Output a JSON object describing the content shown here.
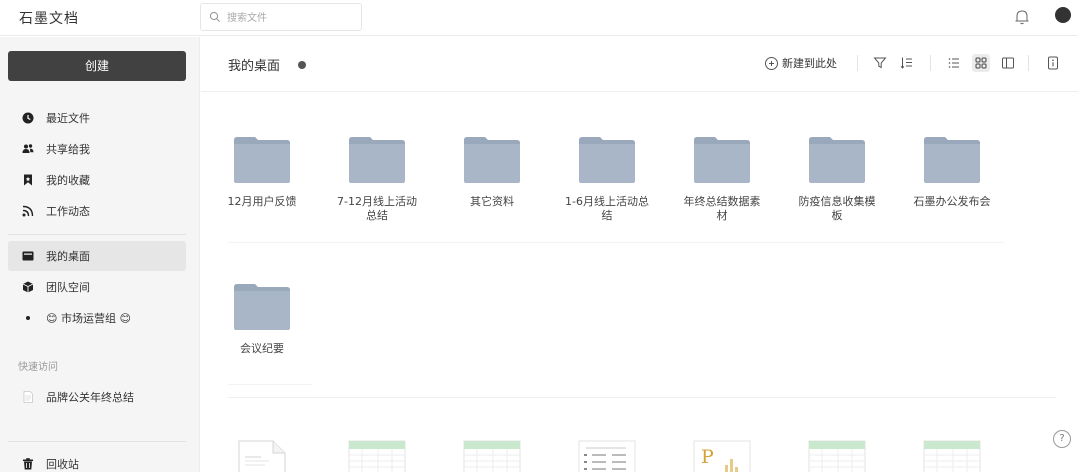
{
  "app": {
    "title": "石墨文档"
  },
  "search": {
    "placeholder": "搜索文件"
  },
  "sidebar": {
    "create_label": "创建",
    "items": [
      {
        "label": "最近文件",
        "icon": "clock-icon"
      },
      {
        "label": "共享给我",
        "icon": "users-icon"
      },
      {
        "label": "我的收藏",
        "icon": "bookmark-icon"
      },
      {
        "label": "工作动态",
        "icon": "rss-icon"
      },
      {
        "label": "我的桌面",
        "icon": "desktop-icon",
        "active": true
      },
      {
        "label": "团队空间",
        "icon": "cube-icon"
      },
      {
        "label": "😊 市场运营组 😊",
        "icon": "dot-icon"
      }
    ],
    "quick_access_label": "快速访问",
    "quick_items": [
      {
        "label": "品牌公关年终总结",
        "icon": "doc-icon"
      }
    ],
    "trash_label": "回收站"
  },
  "main": {
    "title": "我的桌面",
    "toolbar": {
      "new_here_label": "新建到此处"
    },
    "folders": [
      {
        "name": "12月用户反馈"
      },
      {
        "name": "7-12月线上活动总结"
      },
      {
        "name": "其它资料"
      },
      {
        "name": "1-6月线上活动总结"
      },
      {
        "name": "年终总结数据素材"
      },
      {
        "name": "防疫信息收集模板"
      },
      {
        "name": "石墨办公发布会"
      },
      {
        "name": "会议纪要"
      }
    ],
    "files": [
      {
        "type": "doc"
      },
      {
        "type": "sheet"
      },
      {
        "type": "sheet"
      },
      {
        "type": "table"
      },
      {
        "type": "slides"
      },
      {
        "type": "sheet"
      },
      {
        "type": "sheet"
      }
    ],
    "help_label": "?"
  },
  "colors": {
    "folder": "#a9b6c8",
    "folder_tab": "#9aa8bc",
    "create_button": "#414141",
    "sheet_header": "#c9e8cd",
    "slides_accent": "#d4a23a"
  }
}
